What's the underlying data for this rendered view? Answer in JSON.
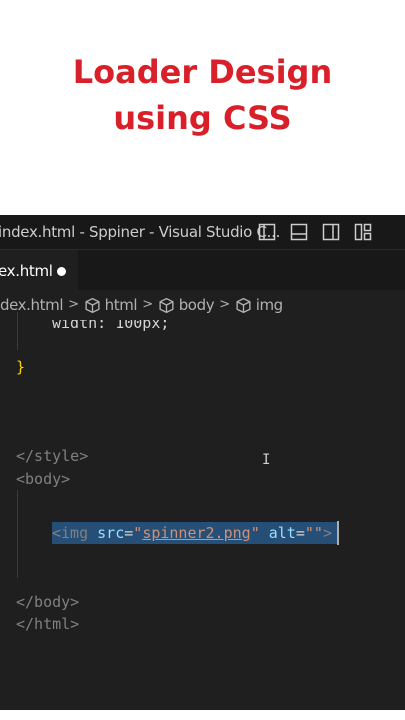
{
  "banner": {
    "line1": "Loader Design",
    "line2": "using CSS",
    "color": "#d9202a"
  },
  "window": {
    "title": "index.html - Sppiner - Visual Studio C...",
    "icons": [
      "toggle-primary-sidebar-icon",
      "toggle-panel-icon",
      "toggle-secondary-sidebar-icon",
      "customize-layout-icon"
    ]
  },
  "tab": {
    "label": "ex.html",
    "modified": true
  },
  "breadcrumb": {
    "file": "dex.html",
    "items": [
      "html",
      "body",
      "img"
    ]
  },
  "code": {
    "line_partial": "width: 100px;",
    "close_brace": "}",
    "style_close": "</style>",
    "body_open": "<body>",
    "img_tag_open": "<img",
    "img_attr_src": "src",
    "img_src_value": "spinner2.png",
    "img_attr_alt": "alt",
    "img_alt_value": "\"\"",
    "img_tag_close": ">",
    "body_close": "</body>",
    "html_close": "</html>"
  },
  "theme": {
    "background": "#1f1f1f",
    "selection": "#264f78"
  }
}
